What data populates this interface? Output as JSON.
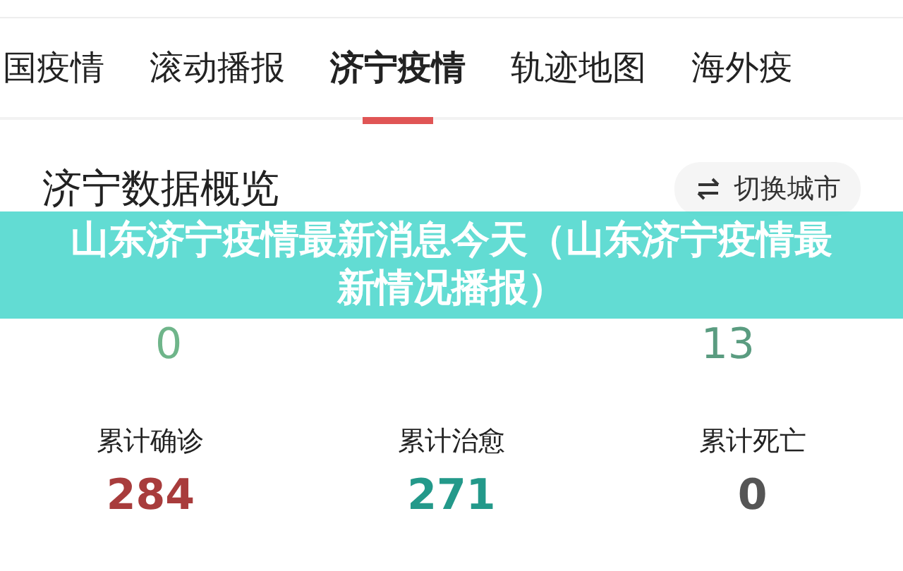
{
  "tabs": [
    {
      "label": "国疫情",
      "selected": false
    },
    {
      "label": "滚动播报",
      "selected": false
    },
    {
      "label": "济宁疫情",
      "selected": true
    },
    {
      "label": "轨迹地图",
      "selected": false
    },
    {
      "label": "海外疫",
      "selected": false
    }
  ],
  "overview": {
    "title": "济宁数据概览",
    "switch_button": "切换城市"
  },
  "new_stats": [
    {
      "value": "0",
      "color": "#6fb58a"
    },
    {
      "value": "13",
      "color": "#5a9c80"
    }
  ],
  "total_stats": [
    {
      "label": "累计确诊",
      "value": "284",
      "color": "#a83c3c"
    },
    {
      "label": "累计治愈",
      "value": "271",
      "color": "#23998a"
    },
    {
      "label": "累计死亡",
      "value": "0",
      "color": "#555555"
    }
  ],
  "banner": {
    "title": "山东济宁疫情最新消息今天（山东济宁疫情最新情况播报）"
  }
}
